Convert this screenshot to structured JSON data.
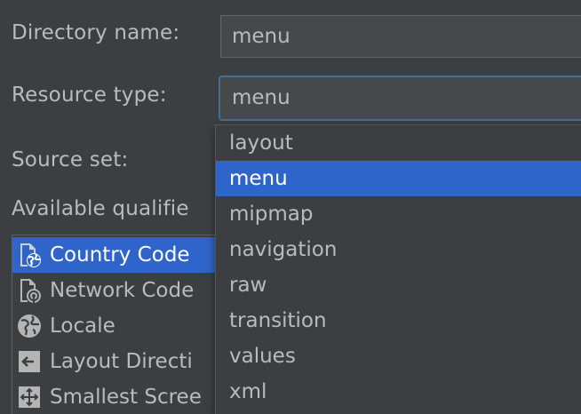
{
  "form": {
    "directory_name_label": "Directory name:",
    "directory_name_value": "menu",
    "resource_type_label": "Resource type:",
    "resource_type_value": "menu",
    "source_set_label": "Source set:",
    "available_qualifiers_label": "Available qualifie"
  },
  "qualifiers": {
    "items": [
      {
        "label": "Country Code",
        "icon": "country-code-icon",
        "selected": true
      },
      {
        "label": "Network Code",
        "icon": "network-code-icon",
        "selected": false
      },
      {
        "label": "Locale",
        "icon": "globe-icon",
        "selected": false
      },
      {
        "label": "Layout Directi",
        "icon": "layout-direction-icon",
        "selected": false
      },
      {
        "label": "Smallest Scree",
        "icon": "smallest-screen-icon",
        "selected": false
      }
    ]
  },
  "dropdown": {
    "options": [
      {
        "label": "layout",
        "selected": false
      },
      {
        "label": "menu",
        "selected": true
      },
      {
        "label": "mipmap",
        "selected": false
      },
      {
        "label": "navigation",
        "selected": false
      },
      {
        "label": "raw",
        "selected": false
      },
      {
        "label": "transition",
        "selected": false
      },
      {
        "label": "values",
        "selected": false
      },
      {
        "label": "xml",
        "selected": false
      }
    ]
  },
  "colors": {
    "background": "#3c3f41",
    "selection": "#2f65ca",
    "focus_border": "#466d94",
    "text": "#bbbbbb"
  }
}
